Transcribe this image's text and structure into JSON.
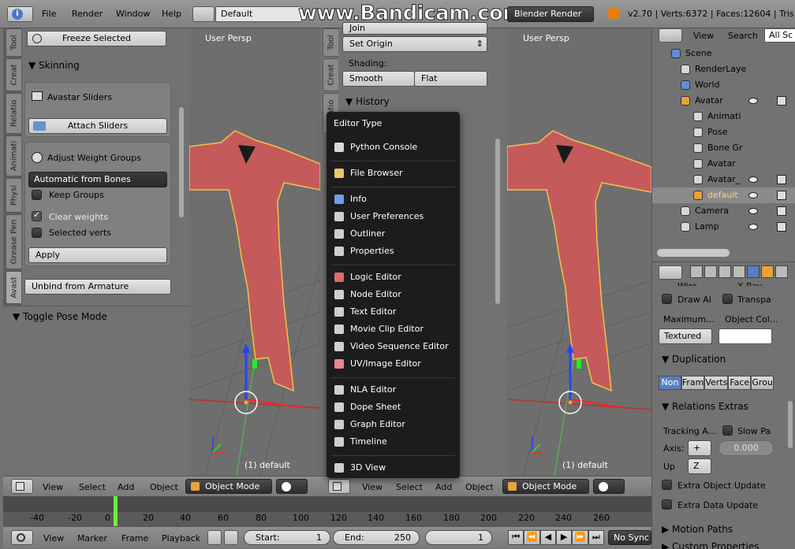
{
  "topbar": {
    "menus": [
      "File",
      "Render",
      "Window",
      "Help"
    ],
    "screen_layout": "Default",
    "watermark": "www.Bandicam.com",
    "render_engine": "Blender Render",
    "stats": "v2.70 | Verts:6372 | Faces:12604 | Tris"
  },
  "left_tabs": [
    "Tool",
    "Creat",
    "Relatio",
    "Animati",
    "Physi",
    "Grease Pen",
    "Avast"
  ],
  "left_panel": {
    "freeze_selected": "Freeze Selected",
    "skinning_header": "Skinning",
    "avastar_sliders": "Avastar Sliders",
    "attach_sliders": "Attach Sliders",
    "adjust_weight_groups": "Adjust Weight Groups",
    "weight_source": "Automatic from Bones",
    "keep_groups": "Keep Groups",
    "clear_weights": "Clear weights",
    "selected_verts": "Selected verts",
    "apply": "Apply",
    "unbind": "Unbind from Armature",
    "toggle_pose_header": "Toggle Pose Mode"
  },
  "viewport_left": {
    "label": "User Persp",
    "object": "(1) default"
  },
  "viewport_right": {
    "label": "User Persp",
    "object": "(1) default"
  },
  "mid_tabs": [
    "Tool",
    "Creat",
    "Relatio"
  ],
  "mid_panel": {
    "join": "Join",
    "set_origin": "Set Origin",
    "shading_label": "Shading:",
    "smooth": "Smooth",
    "flat": "Flat",
    "history_header": "History"
  },
  "editor_menu": {
    "title": "Editor Type",
    "groups": [
      [
        {
          "label": "Python Console",
          "icon": "python-icon",
          "color": "#d8d8d8"
        }
      ],
      [
        {
          "label": "File Browser",
          "icon": "folder-icon",
          "color": "#e8c76a"
        }
      ],
      [
        {
          "label": "Info",
          "icon": "info-icon",
          "color": "#6f9fe8"
        },
        {
          "label": "User Preferences",
          "icon": "preferences-icon",
          "color": "#cfcfcf"
        },
        {
          "label": "Outliner",
          "icon": "outliner-icon",
          "color": "#cfcfcf"
        },
        {
          "label": "Properties",
          "icon": "properties-icon",
          "color": "#cfcfcf"
        }
      ],
      [
        {
          "label": "Logic Editor",
          "icon": "logic-icon",
          "color": "#e06a6a"
        },
        {
          "label": "Node Editor",
          "icon": "node-icon",
          "color": "#cfcfcf"
        },
        {
          "label": "Text Editor",
          "icon": "text-icon",
          "color": "#cfcfcf"
        },
        {
          "label": "Movie Clip Editor",
          "icon": "movie-clip-icon",
          "color": "#cfcfcf"
        },
        {
          "label": "Video Sequence Editor",
          "icon": "sequence-icon",
          "color": "#cfcfcf"
        },
        {
          "label": "UV/Image Editor",
          "icon": "image-icon",
          "color": "#e48a8a"
        }
      ],
      [
        {
          "label": "NLA Editor",
          "icon": "nla-icon",
          "color": "#cfcfcf"
        },
        {
          "label": "Dope Sheet",
          "icon": "dopesheet-icon",
          "color": "#cfcfcf"
        },
        {
          "label": "Graph Editor",
          "icon": "graph-icon",
          "color": "#cfcfcf"
        },
        {
          "label": "Timeline",
          "icon": "timeline-icon",
          "color": "#cfcfcf"
        }
      ],
      [
        {
          "label": "3D View",
          "icon": "cube-icon",
          "color": "#cfcfcf"
        }
      ]
    ]
  },
  "view3d_header": {
    "view": "View",
    "select": "Select",
    "add": "Add",
    "object": "Object",
    "mode": "Object Mode"
  },
  "outliner": {
    "view": "View",
    "search": "Search",
    "filter": "All Sc",
    "rows": [
      {
        "label": "Scene"
      },
      {
        "label": "RenderLaye"
      },
      {
        "label": "World"
      },
      {
        "label": "Avatar"
      },
      {
        "label": "Animati"
      },
      {
        "label": "Pose"
      },
      {
        "label": "Bone Gr"
      },
      {
        "label": "Avatar"
      },
      {
        "label": "Avatar_"
      },
      {
        "label": "default"
      },
      {
        "label": "Camera"
      },
      {
        "label": "Lamp"
      }
    ]
  },
  "properties": {
    "wire": "Wire",
    "xray": "X-Ray",
    "draw_all": "Draw Al",
    "transparency": "Transpa",
    "maximum": "Maximum...",
    "object_color": "Object Col...",
    "display": "Textured",
    "duplication_header": "Duplication",
    "dup_options": [
      "Non",
      "Fram",
      "Verts",
      "Face",
      "Grou"
    ],
    "relations_header": "Relations Extras",
    "tracking": "Tracking A...",
    "slow_parent": "Slow Pa",
    "axis_label": "Axis:",
    "axis_value": "+",
    "up_label": "Up",
    "up_value": "Z",
    "offset": "0.000",
    "extra_object_update": "Extra Object Update",
    "extra_data_update": "Extra Data Update",
    "motion_paths_header": "Motion Paths",
    "custom_properties_header": "Custom Properties"
  },
  "timeline": {
    "ticks": [
      "-40",
      "-20",
      "0",
      "20",
      "40",
      "60",
      "80",
      "100",
      "120",
      "140",
      "160",
      "180",
      "200",
      "220",
      "240",
      "260"
    ],
    "current_frame": 1,
    "menus": [
      "View",
      "Marker",
      "Frame",
      "Playback"
    ],
    "start_label": "Start:",
    "start_value": "1",
    "end_label": "End:",
    "end_value": "250",
    "frame_value": "1",
    "sync": "No Sync"
  }
}
